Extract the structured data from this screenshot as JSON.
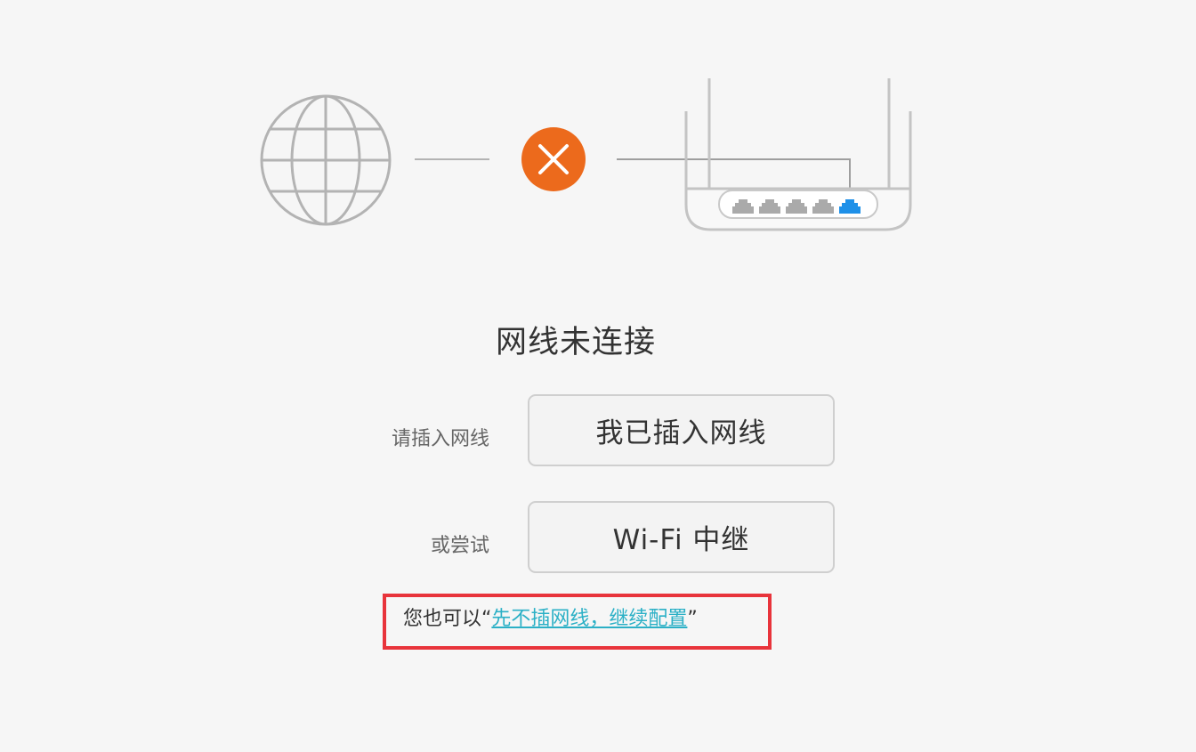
{
  "diagram": {
    "internet_icon": "globe-icon",
    "status_icon": "error-x-icon",
    "device_icon": "router-icon",
    "status_color": "#ec6a1c",
    "active_port_color": "#1e90e8",
    "line_color": "#b3b3b3"
  },
  "title": "网线未连接",
  "rows": {
    "plugged": {
      "label": "请插入网线",
      "button": "我已插入网线"
    },
    "wifi": {
      "label": "或尝试",
      "button": "Wi-Fi 中继"
    }
  },
  "hint": {
    "prefix": "您也可以“",
    "link": "先不插网线，继续配置",
    "suffix": "”"
  },
  "colors": {
    "link": "#2bb0c6",
    "highlight": "#e8343b",
    "background": "#f6f6f6"
  }
}
